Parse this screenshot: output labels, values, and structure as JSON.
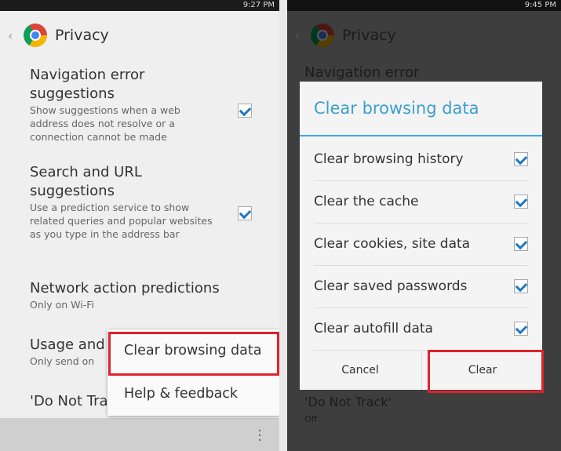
{
  "left": {
    "status": "9:27 PM",
    "title": "Privacy",
    "settings": [
      {
        "title": "Navigation error suggestions",
        "desc": "Show suggestions when a web address does not resolve or a connection cannot be made",
        "checked": true
      },
      {
        "title": "Search and URL suggestions",
        "desc": "Use a prediction service to show related queries and popular websites as you type in the address bar",
        "checked": true
      },
      {
        "title": "Network action predictions",
        "desc": "Only on Wi-Fi"
      },
      {
        "title": "Usage and",
        "desc": "Only send on"
      },
      {
        "title": "'Do Not Tra"
      }
    ],
    "menu": [
      "Clear browsing data",
      "Help & feedback"
    ]
  },
  "right": {
    "status": "9:45 PM",
    "title": "Privacy",
    "bg_first": "Navigation error",
    "bg_last_title": "'Do Not Track'",
    "bg_last_desc": "Off",
    "dialog": {
      "title": "Clear browsing data",
      "options": [
        {
          "label": "Clear browsing history",
          "checked": true
        },
        {
          "label": "Clear the cache",
          "checked": true
        },
        {
          "label": "Clear cookies, site data",
          "checked": true
        },
        {
          "label": "Clear saved passwords",
          "checked": true
        },
        {
          "label": "Clear autofill data",
          "checked": true
        }
      ],
      "cancel": "Cancel",
      "clear": "Clear"
    }
  },
  "colors": {
    "accent": "#3a9fd0",
    "highlight": "#e0222a",
    "check": "#1e78c8"
  }
}
